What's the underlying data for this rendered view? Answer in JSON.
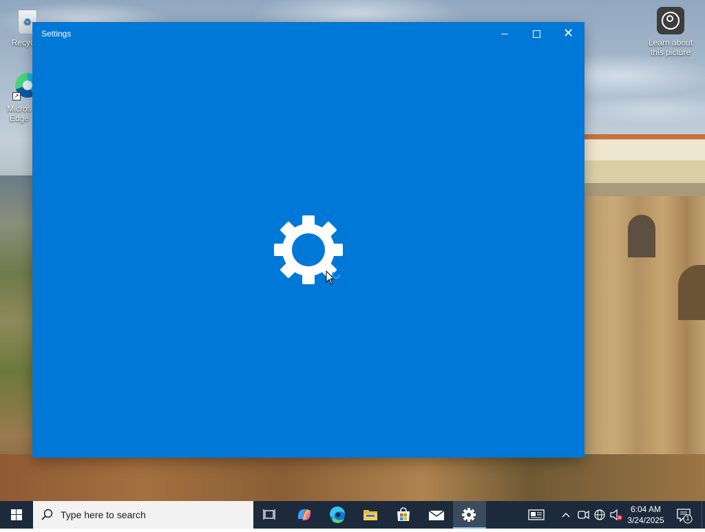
{
  "desktop": {
    "icons": [
      {
        "label": "Recycle"
      },
      {
        "label": "Micros Edge"
      },
      {
        "label": "Learn about this picture"
      }
    ]
  },
  "window": {
    "title": "Settings",
    "background_color": "#0078d7",
    "caption_buttons": {
      "minimize": "minimize",
      "maximize": "maximize",
      "close": "close"
    },
    "splash_icon": "gear-icon"
  },
  "taskbar": {
    "search_placeholder": "Type here to search",
    "pinned_apps": [
      "task-view-icon",
      "copilot-icon",
      "edge-icon",
      "file-explorer-icon",
      "store-icon",
      "mail-icon",
      "settings-icon"
    ],
    "active_app": "settings-icon",
    "tray_icons": [
      "news-icon",
      "chevron-up-icon",
      "meet-now-icon",
      "network-icon",
      "volume-muted-icon"
    ],
    "time": "6:04 AM",
    "date": "3/24/2025",
    "notification_count": "1"
  }
}
